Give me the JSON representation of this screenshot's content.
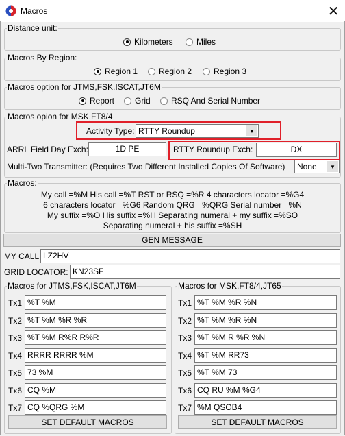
{
  "window": {
    "title": "Macros",
    "close_glyph": "✕"
  },
  "distance_unit": {
    "legend": "Distance unit:",
    "options": [
      {
        "label": "Kilometers",
        "selected": true
      },
      {
        "label": "Miles",
        "selected": false
      }
    ]
  },
  "macros_by_region": {
    "legend": "Macros By Region:",
    "options": [
      {
        "label": "Region 1",
        "selected": true
      },
      {
        "label": "Region 2",
        "selected": false
      },
      {
        "label": "Region 3",
        "selected": false
      }
    ]
  },
  "jtms_option": {
    "legend": "Macros option for JTMS,FSK,ISCAT,JT6M",
    "options": [
      {
        "label": "Report",
        "selected": true
      },
      {
        "label": "Grid",
        "selected": false
      },
      {
        "label": "RSQ And Serial Number",
        "selected": false
      }
    ]
  },
  "msk_option": {
    "legend": "Macros opion for MSK,FT8/4",
    "activity_type_label": "Activity Type:",
    "activity_type_value": "RTTY Roundup",
    "arrl_label": "ARRL Field Day Exch:",
    "arrl_value": "1D PE",
    "rtty_label": "RTTY Roundup Exch:",
    "rtty_value": "DX",
    "multi_two_label": "Multi-Two Transmitter: (Requires Two Different Installed Copies Of Software)",
    "multi_two_value": "None"
  },
  "macros_help": {
    "legend": "Macros:",
    "lines": [
      "My call =%M  His call =%T  RST or RSQ =%R  4 characters locator =%G4",
      "6 characters locator =%G6  Random QRG =%QRG  Serial number =%N",
      "My suffix =%O  His suffix =%H  Separating numeral + my suffix =%SO",
      "Separating numeral + his suffix =%SH"
    ]
  },
  "gen_message_label": "GEN MESSAGE",
  "my_call": {
    "label": "MY CALL:",
    "value": "LZ2HV"
  },
  "grid_locator": {
    "label": "GRID LOCATOR:",
    "value": "KN23SF"
  },
  "jtms_macros": {
    "legend": "Macros for JTMS,FSK,ISCAT,JT6M",
    "rows": [
      {
        "label": "Tx1",
        "value": "%T %M"
      },
      {
        "label": "Tx2",
        "value": "%T %M %R %R"
      },
      {
        "label": "Tx3",
        "value": "%T %M R%R R%R"
      },
      {
        "label": "Tx4",
        "value": "RRRR RRRR %M"
      },
      {
        "label": "Tx5",
        "value": "73 %M"
      },
      {
        "label": "Tx6",
        "value": "CQ %M"
      },
      {
        "label": "Tx7",
        "value": "CQ %QRG %M"
      }
    ],
    "default_label": "SET DEFAULT MACROS"
  },
  "msk_macros": {
    "legend": "Macros for MSK,FT8/4,JT65",
    "rows": [
      {
        "label": "Tx1",
        "value": "%T %M %R %N"
      },
      {
        "label": "Tx2",
        "value": "%T %M %R %N"
      },
      {
        "label": "Tx3",
        "value": "%T %M R %R %N"
      },
      {
        "label": "Tx4",
        "value": "%T %M RR73"
      },
      {
        "label": "Tx5",
        "value": "%T %M 73"
      },
      {
        "label": "Tx6",
        "value": "CQ RU %M %G4"
      },
      {
        "label": "Tx7",
        "value": "%M QSOB4"
      }
    ],
    "default_label": "SET DEFAULT MACROS"
  },
  "colors": {
    "highlight_border": "#e0202a",
    "window_bg": "#f0f0f0"
  }
}
